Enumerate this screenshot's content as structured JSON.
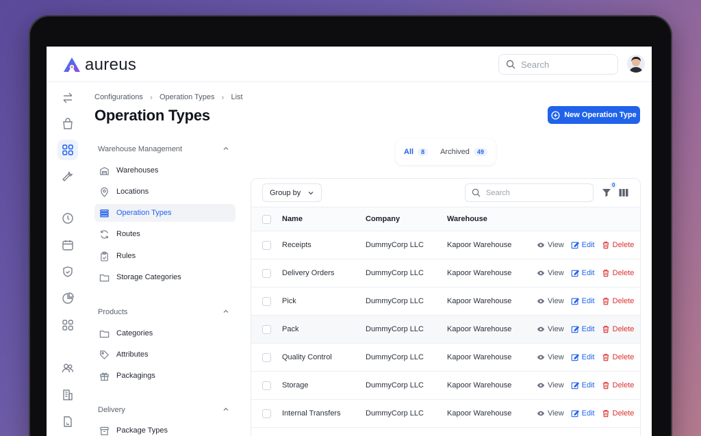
{
  "app": {
    "name": "aureus"
  },
  "header": {
    "search_placeholder": "Search"
  },
  "breadcrumb": [
    "Configurations",
    "Operation Types",
    "List"
  ],
  "page": {
    "title": "Operation Types",
    "new_button": "New Operation Type"
  },
  "subnav": {
    "groups": [
      {
        "title": "Warehouse Management",
        "items": [
          {
            "label": "Warehouses",
            "icon": "warehouse-icon"
          },
          {
            "label": "Locations",
            "icon": "map-pin-icon"
          },
          {
            "label": "Operation Types",
            "icon": "stack-icon",
            "active": true
          },
          {
            "label": "Routes",
            "icon": "refresh-icon"
          },
          {
            "label": "Rules",
            "icon": "clipboard-check-icon"
          },
          {
            "label": "Storage Categories",
            "icon": "folder-icon"
          }
        ]
      },
      {
        "title": "Products",
        "items": [
          {
            "label": "Categories",
            "icon": "folder-icon"
          },
          {
            "label": "Attributes",
            "icon": "tag-icon"
          },
          {
            "label": "Packagings",
            "icon": "gift-icon"
          }
        ]
      },
      {
        "title": "Delivery",
        "items": [
          {
            "label": "Package Types",
            "icon": "archive-icon"
          }
        ]
      }
    ]
  },
  "tabs": [
    {
      "label": "All",
      "count": "8"
    },
    {
      "label": "Archived",
      "count": "49"
    }
  ],
  "toolbar": {
    "group_by": "Group by",
    "search_placeholder": "Search",
    "filter_count": "0"
  },
  "table": {
    "columns": [
      "Name",
      "Company",
      "Warehouse"
    ],
    "actions": {
      "view": "View",
      "edit": "Edit",
      "delete": "Delete"
    },
    "rows": [
      {
        "name": "Receipts",
        "company": "DummyCorp LLC",
        "warehouse": "Kapoor Warehouse"
      },
      {
        "name": "Delivery Orders",
        "company": "DummyCorp LLC",
        "warehouse": "Kapoor Warehouse"
      },
      {
        "name": "Pick",
        "company": "DummyCorp LLC",
        "warehouse": "Kapoor Warehouse"
      },
      {
        "name": "Pack",
        "company": "DummyCorp LLC",
        "warehouse": "Kapoor Warehouse"
      },
      {
        "name": "Quality Control",
        "company": "DummyCorp LLC",
        "warehouse": "Kapoor Warehouse"
      },
      {
        "name": "Storage",
        "company": "DummyCorp LLC",
        "warehouse": "Kapoor Warehouse"
      },
      {
        "name": "Internal Transfers",
        "company": "DummyCorp LLC",
        "warehouse": "Kapoor Warehouse"
      }
    ]
  },
  "colors": {
    "accent": "#2063ea",
    "danger": "#dc2f2f"
  }
}
